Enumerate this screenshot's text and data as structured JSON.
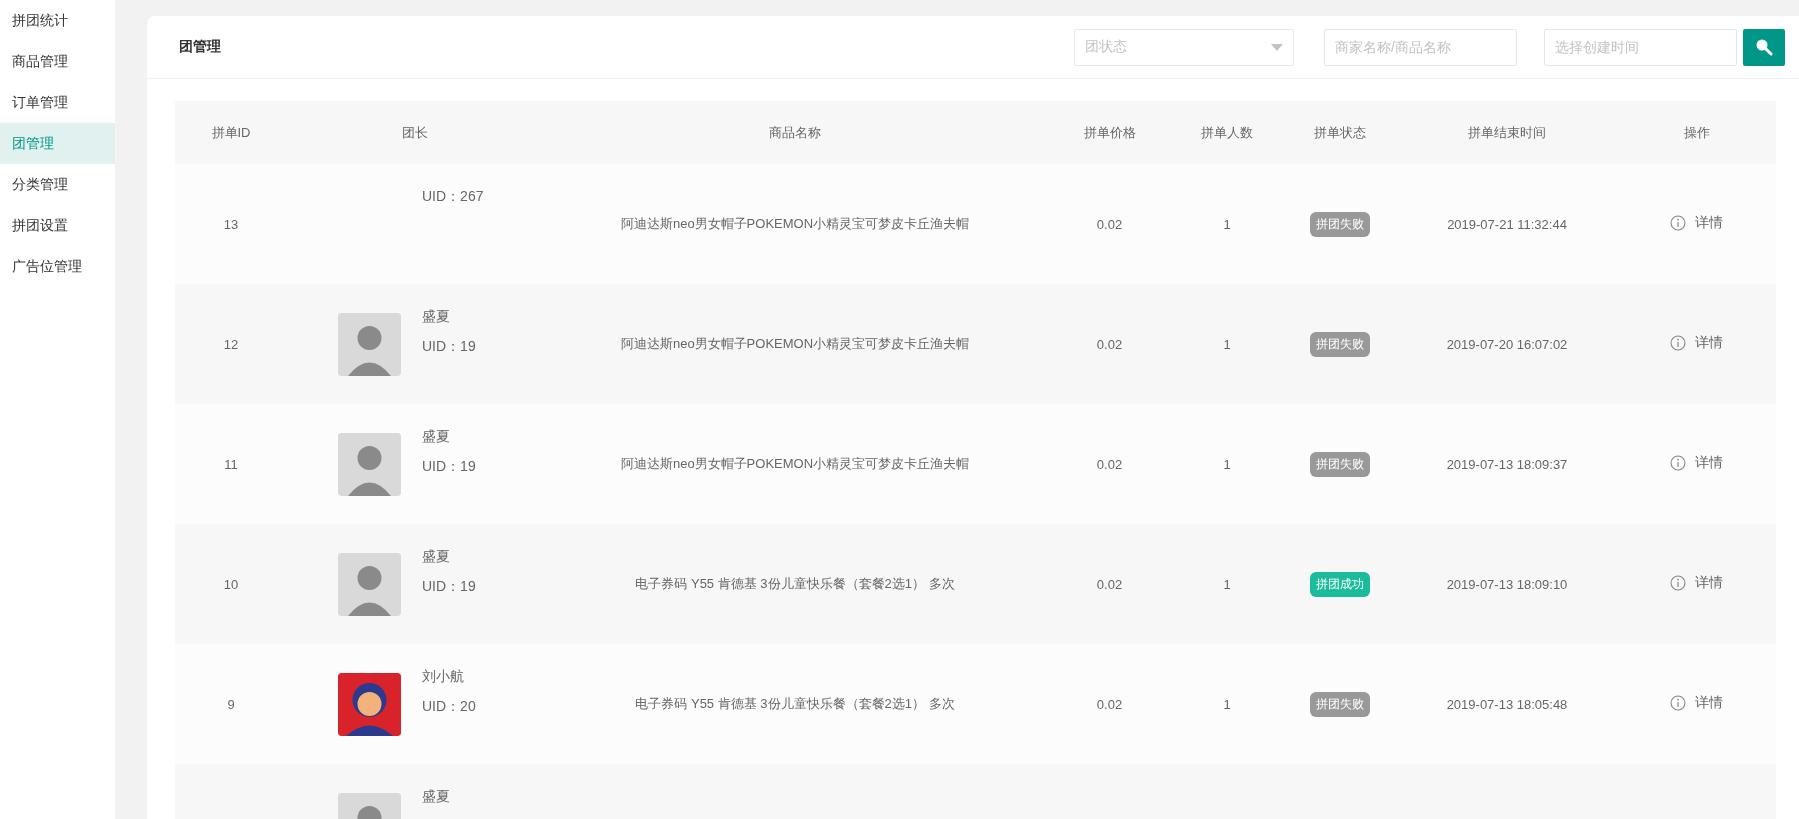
{
  "sidebar": {
    "items": [
      {
        "label": "拼团统计",
        "selected": false
      },
      {
        "label": "商品管理",
        "selected": false
      },
      {
        "label": "订单管理",
        "selected": false
      },
      {
        "label": "团管理",
        "selected": true
      },
      {
        "label": "分类管理",
        "selected": false
      },
      {
        "label": "拼团设置",
        "selected": false
      },
      {
        "label": "广告位管理",
        "selected": false
      }
    ]
  },
  "panel": {
    "title": "团管理",
    "filters": {
      "status_select": {
        "placeholder": "团状态"
      },
      "keyword": {
        "placeholder": "商家名称/商品名称"
      },
      "date": {
        "placeholder": "选择创建时间"
      }
    }
  },
  "table": {
    "columns": [
      "拼单ID",
      "团长",
      "商品名称",
      "拼单价格",
      "拼单人数",
      "拼单状态",
      "拼单结束时间",
      "操作"
    ],
    "rows": [
      {
        "id": "13",
        "leader": {
          "kind": "none",
          "uid": "UID：267"
        },
        "product": "阿迪达斯neo男女帽子POKEMON小精灵宝可梦皮卡丘渔夫帽",
        "price": "0.02",
        "count": "1",
        "status": {
          "label": "拼团失败",
          "kind": "failed"
        },
        "end_time": "2019-07-21 11:32:44",
        "action": "详情"
      },
      {
        "id": "12",
        "leader": {
          "kind": "sketch",
          "name": "盛夏",
          "uid": "UID：19"
        },
        "product": "阿迪达斯neo男女帽子POKEMON小精灵宝可梦皮卡丘渔夫帽",
        "price": "0.02",
        "count": "1",
        "status": {
          "label": "拼团失败",
          "kind": "failed"
        },
        "end_time": "2019-07-20 16:07:02",
        "action": "详情"
      },
      {
        "id": "11",
        "leader": {
          "kind": "sketch",
          "name": "盛夏",
          "uid": "UID：19"
        },
        "product": "阿迪达斯neo男女帽子POKEMON小精灵宝可梦皮卡丘渔夫帽",
        "price": "0.02",
        "count": "1",
        "status": {
          "label": "拼团失败",
          "kind": "failed"
        },
        "end_time": "2019-07-13 18:09:37",
        "action": "详情"
      },
      {
        "id": "10",
        "leader": {
          "kind": "sketch",
          "name": "盛夏",
          "uid": "UID：19"
        },
        "product": "电子券码 Y55 肯德基 3份儿童快乐餐（套餐2选1） 多次",
        "price": "0.02",
        "count": "1",
        "status": {
          "label": "拼团成功",
          "kind": "success"
        },
        "end_time": "2019-07-13 18:09:10",
        "action": "详情"
      },
      {
        "id": "9",
        "leader": {
          "kind": "cartoon",
          "name": "刘小航",
          "uid": "UID：20"
        },
        "product": "电子券码 Y55 肯德基 3份儿童快乐餐（套餐2选1） 多次",
        "price": "0.02",
        "count": "1",
        "status": {
          "label": "拼团失败",
          "kind": "failed"
        },
        "end_time": "2019-07-13 18:05:48",
        "action": "详情"
      },
      {
        "leader": {
          "kind": "sketch",
          "name": "盛夏"
        }
      }
    ]
  }
}
